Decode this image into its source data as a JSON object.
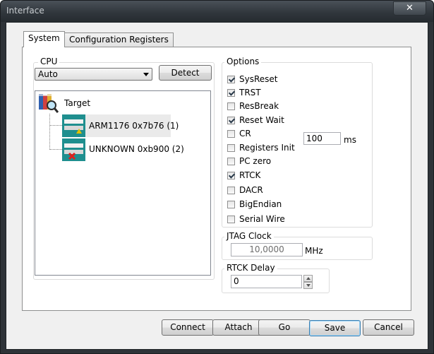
{
  "window": {
    "title": "Interface",
    "close_glyph": "✕"
  },
  "tabs": [
    {
      "label": "System",
      "active": true
    },
    {
      "label": "Configuration Registers",
      "active": false
    }
  ],
  "cpu": {
    "group_label": "CPU",
    "select_value": "Auto",
    "detect_label": "Detect",
    "tree": {
      "root": {
        "label": "Target",
        "icon": "target-book-magnifier-icon"
      },
      "children": [
        {
          "label": "ARM1176 0x7b76 (1)",
          "icon": "device-warning-icon",
          "selected": true
        },
        {
          "label": "UNKNOWN 0xb900 (2)",
          "icon": "device-error-icon",
          "selected": false
        }
      ]
    }
  },
  "options": {
    "group_label": "Options",
    "items": [
      {
        "label": "SysReset",
        "checked": true
      },
      {
        "label": "TRST",
        "checked": true
      },
      {
        "label": "ResBreak",
        "checked": false
      },
      {
        "label": "Reset Wait",
        "checked": true
      },
      {
        "label": "CR",
        "checked": false
      },
      {
        "label": "Registers Init",
        "checked": false
      },
      {
        "label": "PC zero",
        "checked": false
      },
      {
        "label": "RTCK",
        "checked": true
      },
      {
        "label": "DACR",
        "checked": false
      },
      {
        "label": "BigEndian",
        "checked": false
      },
      {
        "label": "Serial Wire",
        "checked": false
      }
    ],
    "reset_wait_value": "100",
    "reset_wait_unit": "ms"
  },
  "jtag": {
    "group_label": "JTAG Clock",
    "value": "10,0000",
    "unit": "MHz"
  },
  "rtck": {
    "group_label": "RTCK Delay",
    "value": "0"
  },
  "footer": {
    "connect": "Connect",
    "attach": "Attach",
    "go": "Go",
    "save": "Save",
    "cancel": "Cancel"
  },
  "colors": {
    "error_mark": "#e0201c",
    "warning_mark": "#e0c000",
    "device_teal": "#1f8f8f"
  }
}
